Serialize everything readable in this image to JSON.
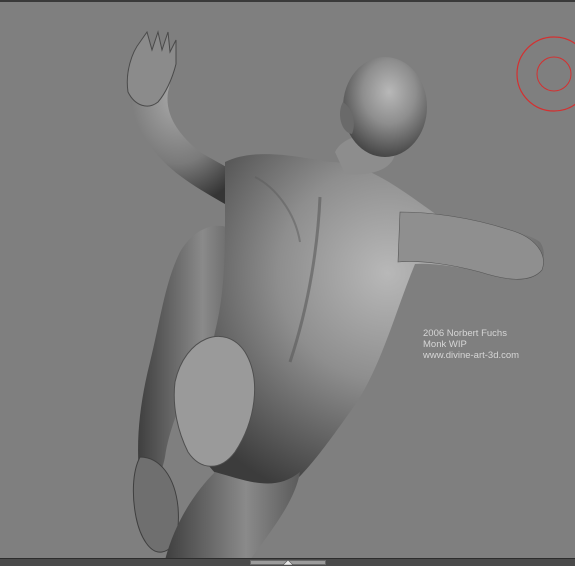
{
  "viewport": {
    "background_color": "#7f7f7f",
    "model": "human-figure-sculpt"
  },
  "brush_cursor": {
    "icon": "brush-circle-icon",
    "color": "#d43030"
  },
  "credit": {
    "line1": "2006 Norbert Fuchs",
    "line2": "Monk WIP",
    "line3": "www.divine-art-3d.com"
  },
  "bottom_bar": {
    "grip_icon": "scroll-grip-icon"
  }
}
